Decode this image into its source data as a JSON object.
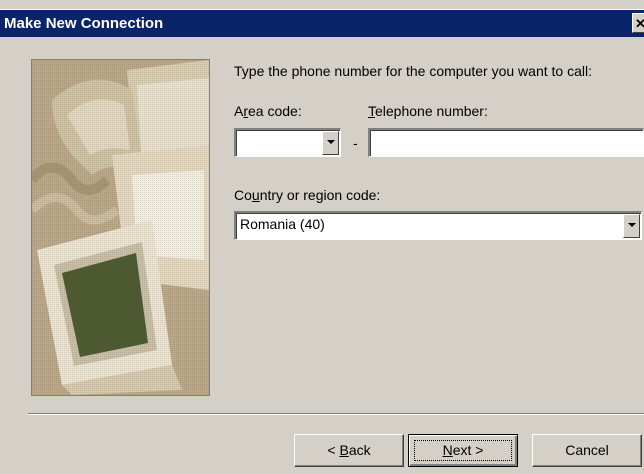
{
  "window": {
    "title": "Make New Connection",
    "close_glyph": "✕"
  },
  "illustration": {
    "name": "computers-phone-illustration",
    "colors": {
      "background": "#bba88a",
      "monitor": "#e8dcc6",
      "screen": "#4c5a32"
    }
  },
  "form": {
    "instruction": "Type the phone number for the computer you want to call:",
    "area_code": {
      "label_pre": "A",
      "label_mnemonic": "r",
      "label_post": "ea code:",
      "value": ""
    },
    "dash": "-",
    "telephone": {
      "label_pre": "",
      "label_mnemonic": "T",
      "label_post": "elephone number:",
      "value": ""
    },
    "country": {
      "label_pre": "Co",
      "label_mnemonic": "u",
      "label_post": "ntry or region code:",
      "value": "Romania (40)"
    }
  },
  "buttons": {
    "back": {
      "prefix": "< ",
      "mnemonic": "B",
      "rest": "ack"
    },
    "next": {
      "mnemonic": "N",
      "rest": "ext >"
    },
    "cancel": {
      "label": "Cancel"
    }
  }
}
